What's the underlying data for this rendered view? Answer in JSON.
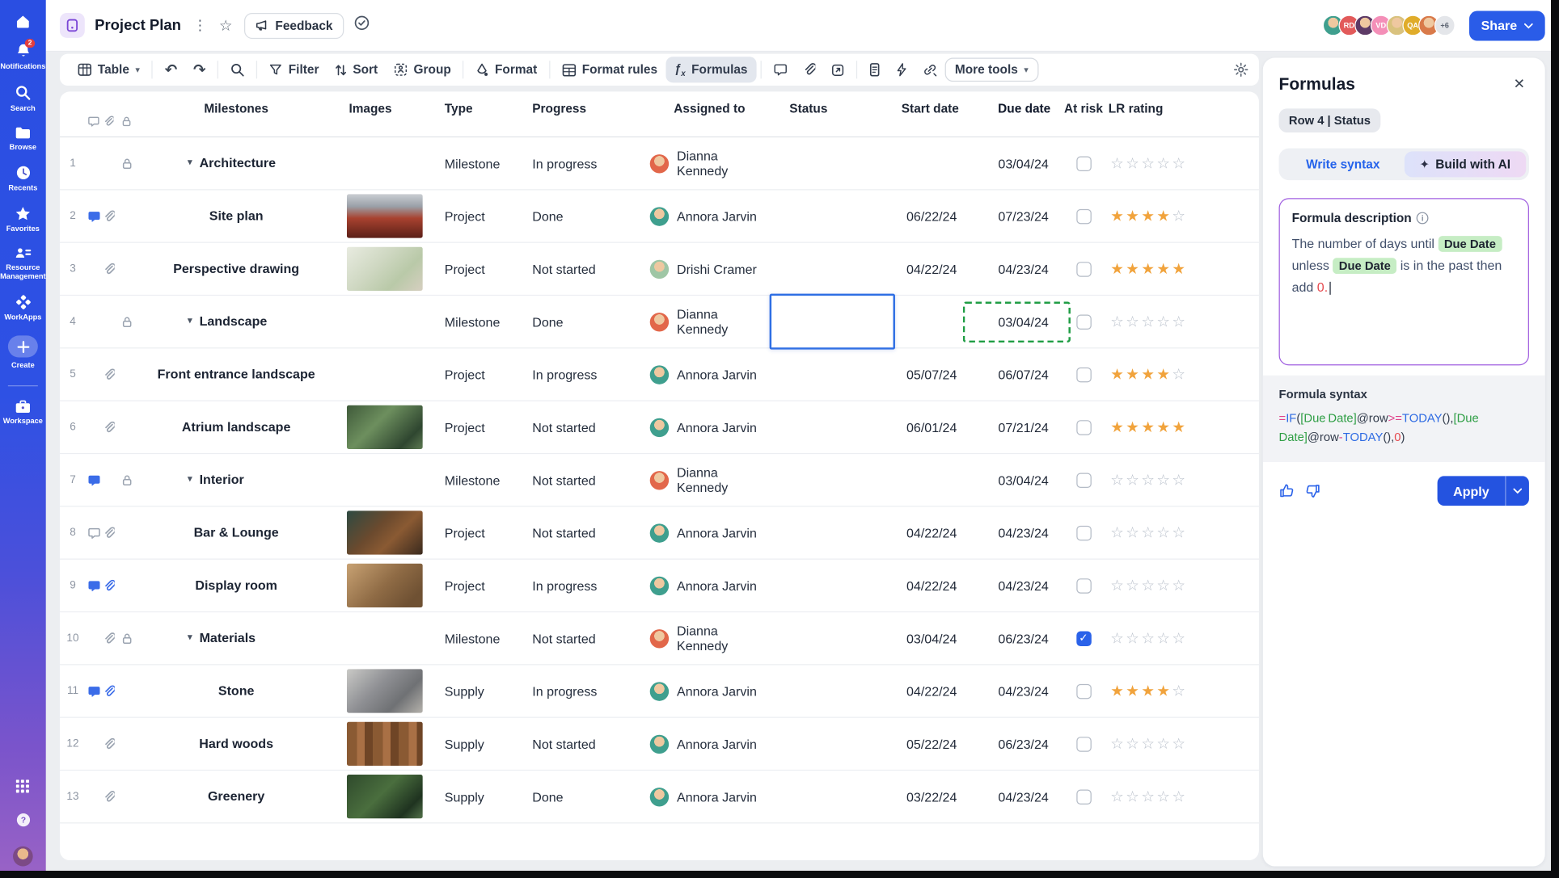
{
  "topbar": {
    "title": "Project Plan",
    "feedback_label": "Feedback",
    "share_label": "Share",
    "avatars": [
      {
        "kind": "photo",
        "label": "",
        "color": "#3f9f8e"
      },
      {
        "kind": "initials",
        "label": "RD",
        "color": "#e25a5a",
        "text": "#ffffff"
      },
      {
        "kind": "photo",
        "label": "",
        "color": "#5d3a66"
      },
      {
        "kind": "initials",
        "label": "VD",
        "color": "#f48fb8",
        "text": "#ffffff"
      },
      {
        "kind": "photo",
        "label": "",
        "color": "#d9c27e"
      },
      {
        "kind": "initials",
        "label": "QA",
        "color": "#e0ac2a",
        "text": "#ffffff"
      },
      {
        "kind": "photo",
        "label": "",
        "color": "#d97a4a"
      },
      {
        "kind": "initials",
        "label": "+6",
        "color": "#e4e6ea",
        "text": "#5a6270"
      }
    ]
  },
  "sidebar": {
    "items": [
      {
        "id": "home",
        "icon": "home-icon",
        "label": ""
      },
      {
        "id": "notifications",
        "icon": "bell-icon",
        "label": "Notifications",
        "badge": "2"
      },
      {
        "id": "search",
        "icon": "search-icon",
        "label": "Search"
      },
      {
        "id": "browse",
        "icon": "folder-icon",
        "label": "Browse"
      },
      {
        "id": "recents",
        "icon": "clock-icon",
        "label": "Recents"
      },
      {
        "id": "favorites",
        "icon": "star-icon",
        "label": "Favorites"
      },
      {
        "id": "resource-management",
        "icon": "people-icon",
        "label": "Resource Management"
      },
      {
        "id": "workapps",
        "icon": "shapes-icon",
        "label": "WorkApps"
      },
      {
        "id": "create",
        "icon": "plus-icon",
        "label": "Create"
      },
      {
        "id": "workspace",
        "icon": "briefcase-icon",
        "label": "Workspace"
      }
    ]
  },
  "toolbar": {
    "table_label": "Table",
    "filter_label": "Filter",
    "sort_label": "Sort",
    "group_label": "Group",
    "format_label": "Format",
    "format_rules_label": "Format rules",
    "formulas_label": "Formulas",
    "more_tools_label": "More tools"
  },
  "table": {
    "headers": {
      "milestones": "Milestones",
      "images": "Images",
      "type": "Type",
      "progress": "Progress",
      "assigned_to": "Assigned to",
      "status": "Status",
      "start_date": "Start date",
      "due_date": "Due date",
      "at_risk": "At risk",
      "lr_rating": "LR rating"
    },
    "rows": [
      {
        "num": "1",
        "icons": [
          "lock"
        ],
        "group": true,
        "name": "Architecture",
        "image": null,
        "type": "Milestone",
        "progress": "In progress",
        "assignee": "Dianna Kennedy",
        "avatar": "#e2674a",
        "start": "",
        "due": "03/04/24",
        "at_risk": false,
        "rating": 0,
        "status_selected": false,
        "due_dashed": false
      },
      {
        "num": "2",
        "icons": [
          "comment-blue",
          "clip"
        ],
        "group": false,
        "name": "Site plan",
        "image": "siteplan",
        "type": "Project",
        "progress": "Done",
        "assignee": "Annora Jarvin",
        "avatar": "#3f9f8e",
        "start": "06/22/24",
        "due": "07/23/24",
        "at_risk": false,
        "rating": 4,
        "status_selected": false,
        "due_dashed": false
      },
      {
        "num": "3",
        "icons": [
          "clip"
        ],
        "group": false,
        "name": "Perspective drawing",
        "image": "perspective",
        "type": "Project",
        "progress": "Not started",
        "assignee": "Drishi Cramer",
        "avatar": "#9fc6a5",
        "start": "04/22/24",
        "due": "04/23/24",
        "at_risk": false,
        "rating": 5,
        "status_selected": false,
        "due_dashed": false
      },
      {
        "num": "4",
        "icons": [
          "lock"
        ],
        "group": true,
        "name": "Landscape",
        "image": null,
        "type": "Milestone",
        "progress": "Done",
        "assignee": "Dianna Kennedy",
        "avatar": "#e2674a",
        "start": "",
        "due": "03/04/24",
        "at_risk": false,
        "rating": 0,
        "status_selected": true,
        "due_dashed": true
      },
      {
        "num": "5",
        "icons": [
          "clip"
        ],
        "group": false,
        "name": "Front entrance landscape",
        "image": null,
        "type": "Project",
        "progress": "In progress",
        "assignee": "Annora Jarvin",
        "avatar": "#3f9f8e",
        "start": "05/07/24",
        "due": "06/07/24",
        "at_risk": false,
        "rating": 4,
        "status_selected": false,
        "due_dashed": false
      },
      {
        "num": "6",
        "icons": [
          "clip"
        ],
        "group": false,
        "name": "Atrium landscape",
        "image": "atrium",
        "type": "Project",
        "progress": "Not started",
        "assignee": "Annora Jarvin",
        "avatar": "#3f9f8e",
        "start": "06/01/24",
        "due": "07/21/24",
        "at_risk": false,
        "rating": 5,
        "status_selected": false,
        "due_dashed": false
      },
      {
        "num": "7",
        "icons": [
          "comment-blue",
          "lock"
        ],
        "group": true,
        "name": "Interior",
        "image": null,
        "type": "Milestone",
        "progress": "Not started",
        "assignee": "Dianna Kennedy",
        "avatar": "#e2674a",
        "start": "",
        "due": "03/04/24",
        "at_risk": false,
        "rating": 0,
        "status_selected": false,
        "due_dashed": false
      },
      {
        "num": "8",
        "icons": [
          "comment",
          "clip"
        ],
        "group": false,
        "name": "Bar & Lounge",
        "image": "bar",
        "type": "Project",
        "progress": "Not started",
        "assignee": "Annora Jarvin",
        "avatar": "#3f9f8e",
        "start": "04/22/24",
        "due": "04/23/24",
        "at_risk": false,
        "rating": 0,
        "status_selected": false,
        "due_dashed": false
      },
      {
        "num": "9",
        "icons": [
          "comment-blue",
          "clip-blue"
        ],
        "group": false,
        "name": "Display room",
        "image": "display",
        "type": "Project",
        "progress": "In progress",
        "assignee": "Annora Jarvin",
        "avatar": "#3f9f8e",
        "start": "04/22/24",
        "due": "04/23/24",
        "at_risk": false,
        "rating": 0,
        "status_selected": false,
        "due_dashed": false
      },
      {
        "num": "10",
        "icons": [
          "clip",
          "lock"
        ],
        "group": true,
        "name": "Materials",
        "image": null,
        "type": "Milestone",
        "progress": "Not started",
        "assignee": "Dianna Kennedy",
        "avatar": "#e2674a",
        "start": "03/04/24",
        "due": "06/23/24",
        "at_risk": true,
        "rating": 0,
        "status_selected": false,
        "due_dashed": false
      },
      {
        "num": "11",
        "icons": [
          "comment-blue",
          "clip-blue"
        ],
        "group": false,
        "name": "Stone",
        "image": "stone",
        "type": "Supply",
        "progress": "In progress",
        "assignee": "Annora Jarvin",
        "avatar": "#3f9f8e",
        "start": "04/22/24",
        "due": "04/23/24",
        "at_risk": false,
        "rating": 4,
        "status_selected": false,
        "due_dashed": false
      },
      {
        "num": "12",
        "icons": [
          "clip"
        ],
        "group": false,
        "name": "Hard woods",
        "image": "wood",
        "type": "Supply",
        "progress": "Not started",
        "assignee": "Annora Jarvin",
        "avatar": "#3f9f8e",
        "start": "05/22/24",
        "due": "06/23/24",
        "at_risk": false,
        "rating": 0,
        "status_selected": false,
        "due_dashed": false
      },
      {
        "num": "13",
        "icons": [
          "clip"
        ],
        "group": false,
        "name": "Greenery",
        "image": "greenery",
        "type": "Supply",
        "progress": "Done",
        "assignee": "Annora Jarvin",
        "avatar": "#3f9f8e",
        "start": "03/22/24",
        "due": "04/23/24",
        "at_risk": false,
        "rating": 0,
        "status_selected": false,
        "due_dashed": false
      }
    ]
  },
  "formulas_panel": {
    "title": "Formulas",
    "context_chip": "Row 4 | Status",
    "write_syntax_label": "Write syntax",
    "build_ai_label": "Build with AI",
    "description_label": "Formula description",
    "description_segments": [
      {
        "t": "text",
        "v": "The number of days until "
      },
      {
        "t": "chip",
        "v": "Due Date"
      },
      {
        "t": "text",
        "v": " unless "
      },
      {
        "t": "chip",
        "v": "Due Date"
      },
      {
        "t": "text",
        "v": " is in the past then add "
      },
      {
        "t": "red",
        "v": "0."
      }
    ],
    "syntax_label": "Formula syntax",
    "syntax_tokens": [
      {
        "c": "pink",
        "v": "="
      },
      {
        "c": "blue",
        "v": "IF"
      },
      {
        "c": "dark",
        "v": "("
      },
      {
        "c": "green",
        "v": "[Due Date]"
      },
      {
        "c": "dark",
        "v": "@row"
      },
      {
        "c": "pink",
        "v": ">="
      },
      {
        "c": "blue",
        "v": "TODAY"
      },
      {
        "c": "dark",
        "v": "(),"
      },
      {
        "c": "green",
        "v": "[Due Date]"
      },
      {
        "c": "dark",
        "v": "@row"
      },
      {
        "c": "pink",
        "v": "-"
      },
      {
        "c": "blue",
        "v": "TODAY"
      },
      {
        "c": "dark",
        "v": "(),"
      },
      {
        "c": "red",
        "v": "0"
      },
      {
        "c": "dark",
        "v": ")"
      }
    ],
    "apply_label": "Apply"
  },
  "colors": {
    "accent_blue": "#2a5ce8",
    "star_filled": "#f1a33c",
    "checkbox_checked": "#2a62e9",
    "dashed_cell_green": "#1f9d44",
    "chip_green_bg": "#c6edc4",
    "sidebar_top": "#2a4ee2",
    "sidebar_bottom": "#9a63c5"
  }
}
